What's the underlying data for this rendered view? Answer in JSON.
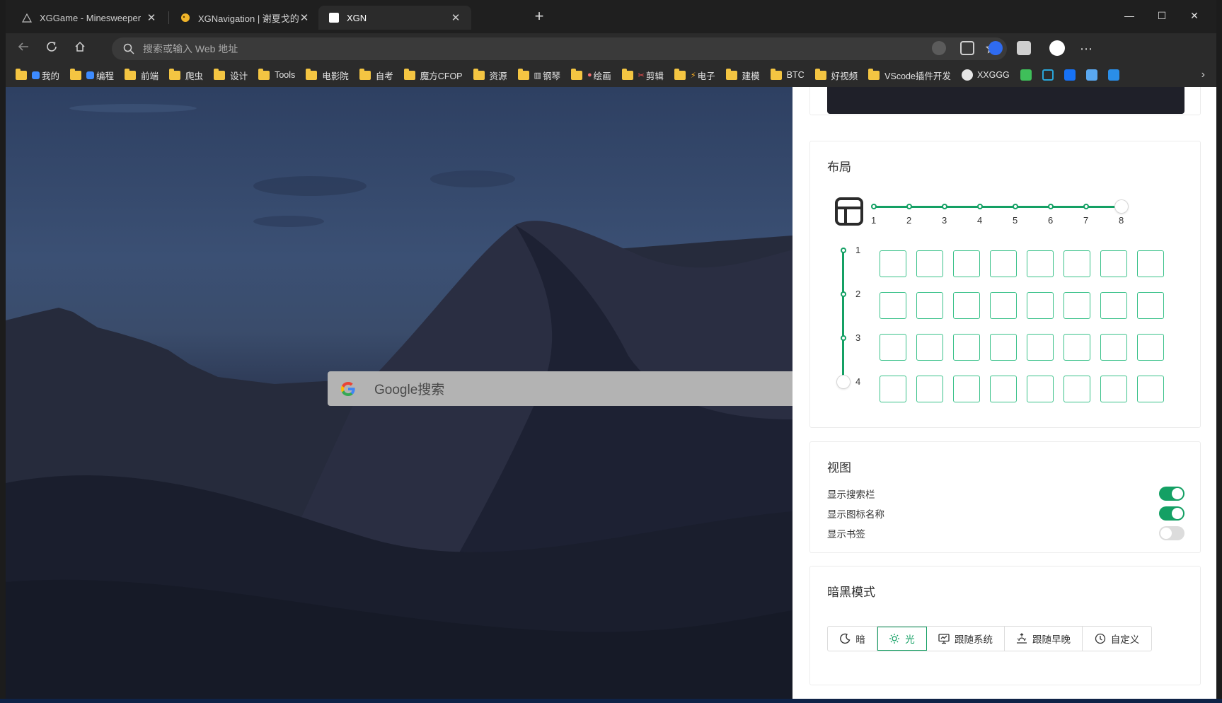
{
  "tabs": [
    {
      "label": "XGGame - Minesweeper",
      "icon": "warning-triangle-icon",
      "active": false
    },
    {
      "label": "XGNavigation | 谢夏戈的博客",
      "icon": "blog-icon",
      "active": false
    },
    {
      "label": "XGN",
      "icon": "page-icon",
      "active": true
    }
  ],
  "address_bar": {
    "placeholder": "搜索或输入 Web 地址",
    "value": ""
  },
  "bookmarks": [
    "我的",
    "编程",
    "前端",
    "爬虫",
    "设计",
    "Tools",
    "电影院",
    "自考",
    "魔方CFOP",
    "资源",
    "钢琴",
    "绘画",
    "剪辑",
    "电子",
    "建模",
    "BTC",
    "好视频",
    "VScode插件开发",
    "XXGGG"
  ],
  "search": {
    "placeholder": "Google搜索"
  },
  "layout_section": {
    "title": "布局",
    "columns": 8,
    "rows": 4,
    "column_ticks": [
      "1",
      "2",
      "3",
      "4",
      "5",
      "6",
      "7",
      "8"
    ],
    "row_ticks": [
      "1",
      "2",
      "3",
      "4"
    ]
  },
  "view_section": {
    "title": "视图",
    "options": [
      {
        "label": "显示搜索栏",
        "enabled": true
      },
      {
        "label": "显示图标名称",
        "enabled": true
      },
      {
        "label": "显示书签",
        "enabled": false
      }
    ]
  },
  "dark_mode_section": {
    "title": "暗黑模式",
    "options": [
      {
        "label": "暗",
        "icon": "moon-icon"
      },
      {
        "label": "光",
        "icon": "sun-icon",
        "selected": true
      },
      {
        "label": "跟随系统",
        "icon": "monitor-icon"
      },
      {
        "label": "跟随早晚",
        "icon": "sunrise-icon"
      },
      {
        "label": "自定义",
        "icon": "clock-icon"
      }
    ]
  },
  "colors": {
    "accent": "#14a064",
    "cell_border": "#39c189",
    "chrome_dark": "#2b2b2b"
  }
}
